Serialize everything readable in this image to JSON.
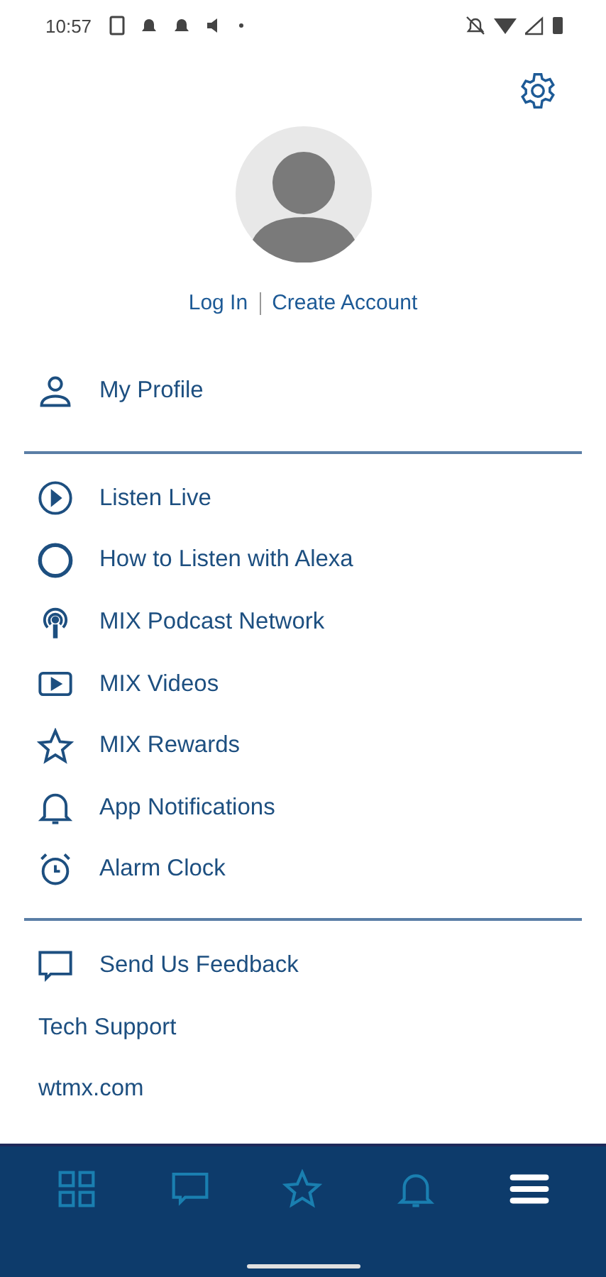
{
  "status_bar": {
    "time": "10:57"
  },
  "account": {
    "links": [
      "Log In",
      "Create Account"
    ]
  },
  "profile": {
    "label": "My Profile",
    "kind": "person"
  },
  "menu": [
    {
      "label": "Listen Live",
      "kind": "play"
    },
    {
      "label": "How to Listen with Alexa",
      "kind": "ring"
    },
    {
      "label": "MIX Podcast Network",
      "kind": "podcast"
    },
    {
      "label": "MIX Videos",
      "kind": "video"
    },
    {
      "label": "MIX Rewards",
      "kind": "star"
    },
    {
      "label": "App Notifications",
      "kind": "bell"
    },
    {
      "label": "Alarm Clock",
      "kind": "alarm"
    }
  ],
  "footer_links": [
    {
      "label": "Send Us Feedback",
      "kind": "chat"
    },
    {
      "label": "Tech Support",
      "kind": "plain"
    },
    {
      "label": "wtmx.com",
      "kind": "plain"
    }
  ],
  "bottom_nav": [
    {
      "kind": "grid",
      "selected": false
    },
    {
      "kind": "chat",
      "selected": false
    },
    {
      "kind": "star",
      "selected": false
    },
    {
      "kind": "bell",
      "selected": false
    },
    {
      "kind": "menu",
      "selected": true
    }
  ]
}
